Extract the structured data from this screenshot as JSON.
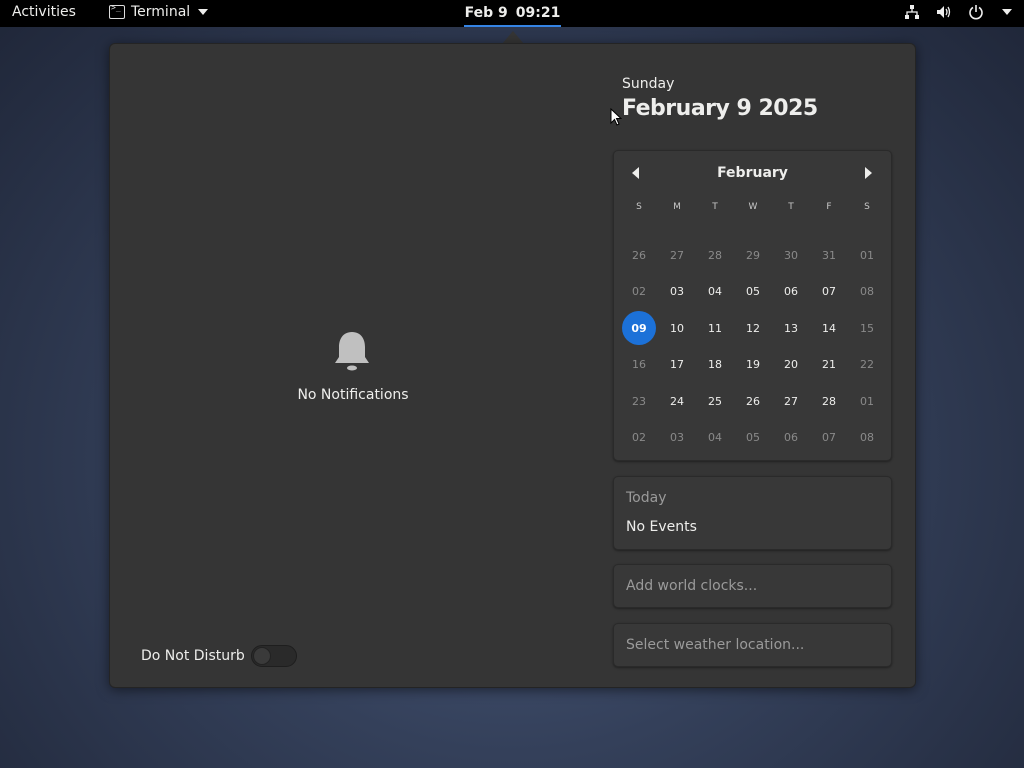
{
  "topbar": {
    "activities": "Activities",
    "app_name": "Terminal",
    "clock_date": "Feb 9",
    "clock_time": "09:21",
    "status_icons": [
      "network-icon",
      "volume-icon",
      "power-icon",
      "chevron-down-icon"
    ]
  },
  "notifications": {
    "empty_text": "No Notifications",
    "dnd_label": "Do Not Disturb",
    "dnd_on": false
  },
  "date_header": {
    "weekday": "Sunday",
    "full_date": "February 9 2025"
  },
  "calendar": {
    "month": "February",
    "weekdays": [
      "S",
      "M",
      "T",
      "W",
      "T",
      "F",
      "S"
    ],
    "weeks": [
      [
        "26",
        "27",
        "28",
        "29",
        "30",
        "31",
        "01"
      ],
      [
        "02",
        "03",
        "04",
        "05",
        "06",
        "07",
        "08"
      ],
      [
        "09",
        "10",
        "11",
        "12",
        "13",
        "14",
        "15"
      ],
      [
        "16",
        "17",
        "18",
        "19",
        "20",
        "21",
        "22"
      ],
      [
        "23",
        "24",
        "25",
        "26",
        "27",
        "28",
        "01"
      ],
      [
        "02",
        "03",
        "04",
        "05",
        "06",
        "07",
        "08"
      ]
    ],
    "today": "09"
  },
  "events": {
    "title": "Today",
    "text": "No Events"
  },
  "world_clocks": {
    "placeholder": "Add world clocks..."
  },
  "weather": {
    "placeholder": "Select weather location..."
  },
  "colors": {
    "accent": "#1c71d8",
    "topbar": "#000000",
    "popup_bg": "#353535"
  }
}
